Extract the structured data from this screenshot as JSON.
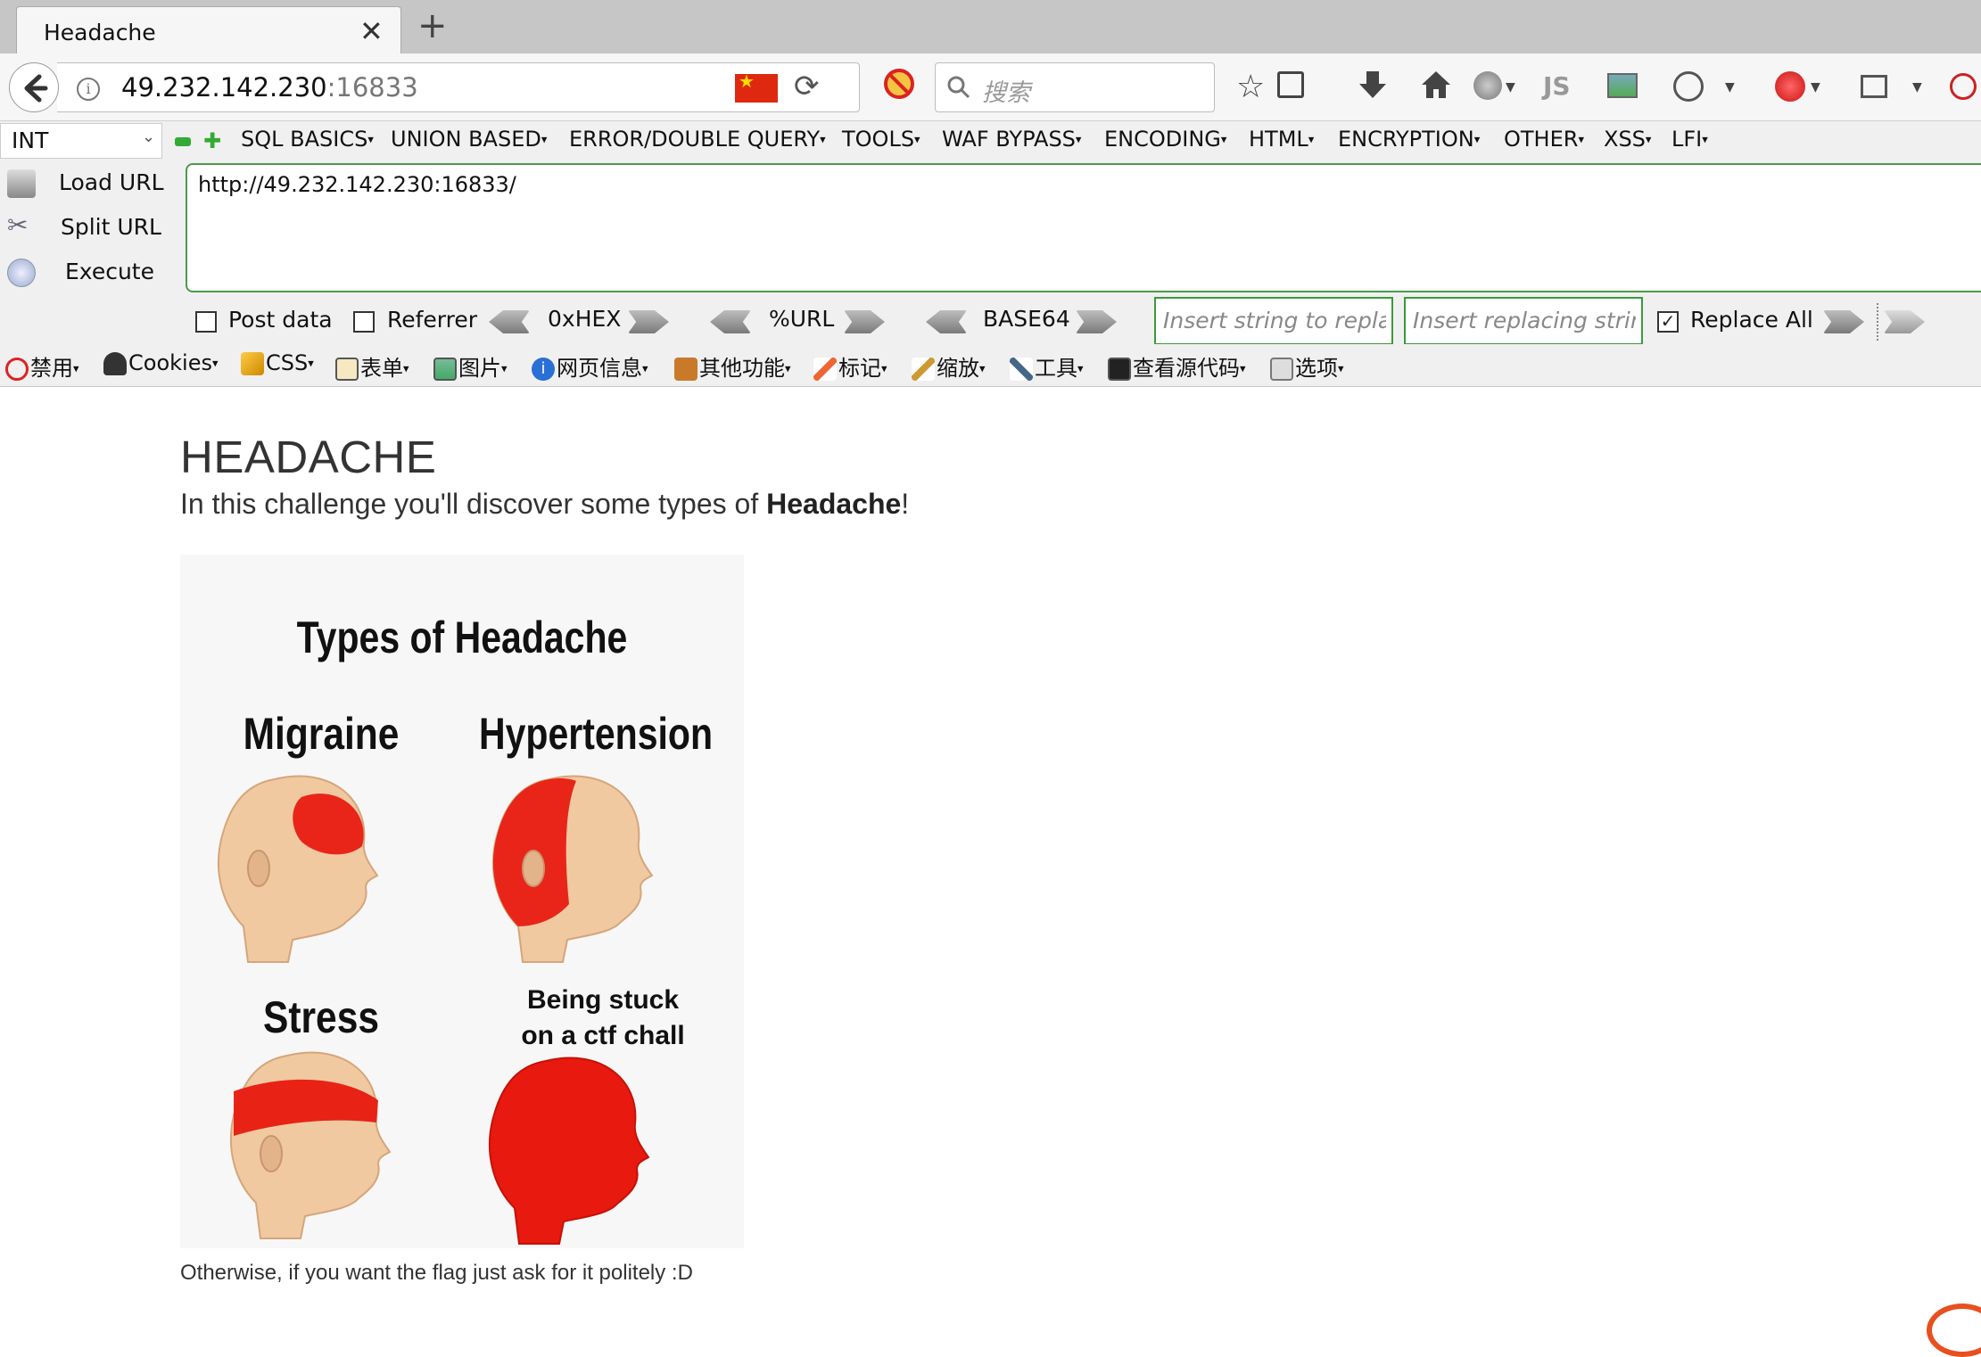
{
  "browser": {
    "tab_title": "Headache",
    "url_host": "49.232.142.230",
    "url_port": ":16833",
    "search_placeholder": "搜索",
    "toolbar_icons": [
      "star-icon",
      "reading-list-icon",
      "download-icon",
      "home-icon",
      "globe-icon",
      "js-icon",
      "image-icon",
      "palette-icon",
      "hackbar-icon",
      "window-icon",
      "zoom-icon"
    ]
  },
  "hackbar": {
    "type_select": "INT",
    "menus": [
      "SQL BASICS",
      "UNION BASED",
      "ERROR/DOUBLE QUERY",
      "TOOLS",
      "WAF BYPASS",
      "ENCODING",
      "HTML",
      "ENCRYPTION",
      "OTHER",
      "XSS",
      "LFI"
    ],
    "load_url": "Load URL",
    "split_url": "Split URL",
    "execute": "Execute",
    "url_value": "http://49.232.142.230:16833/",
    "post_data": "Post data",
    "referrer": "Referrer",
    "hex": "0xHEX",
    "urlenc": "%URL",
    "base64": "BASE64",
    "replace_placeholder": "Insert string to replace",
    "replacing_placeholder": "Insert replacing string",
    "replace_all": "Replace All"
  },
  "cn_toolbar": [
    "禁用",
    "Cookies",
    "CSS",
    "表单",
    "图片",
    "网页信息",
    "其他功能",
    "标记",
    "缩放",
    "工具",
    "查看源代码",
    "选项"
  ],
  "page": {
    "title": "HEADACHE",
    "subtitle_pre": "In this challenge you'll discover some types of ",
    "subtitle_bold": "Headache",
    "subtitle_post": "!",
    "footer": "Otherwise, if you want the flag just ask for it politely :D"
  },
  "meme": {
    "title": "Types of Headache",
    "panel1": "Migraine",
    "panel2": "Hypertension",
    "panel3": "Stress",
    "panel4_line1": "Being stuck",
    "panel4_line2": "on a ctf chall"
  },
  "colors": {
    "hackbar_green": "#4a9a4a",
    "headache_red": "#e8190f",
    "skin": "#f0c9a0"
  }
}
